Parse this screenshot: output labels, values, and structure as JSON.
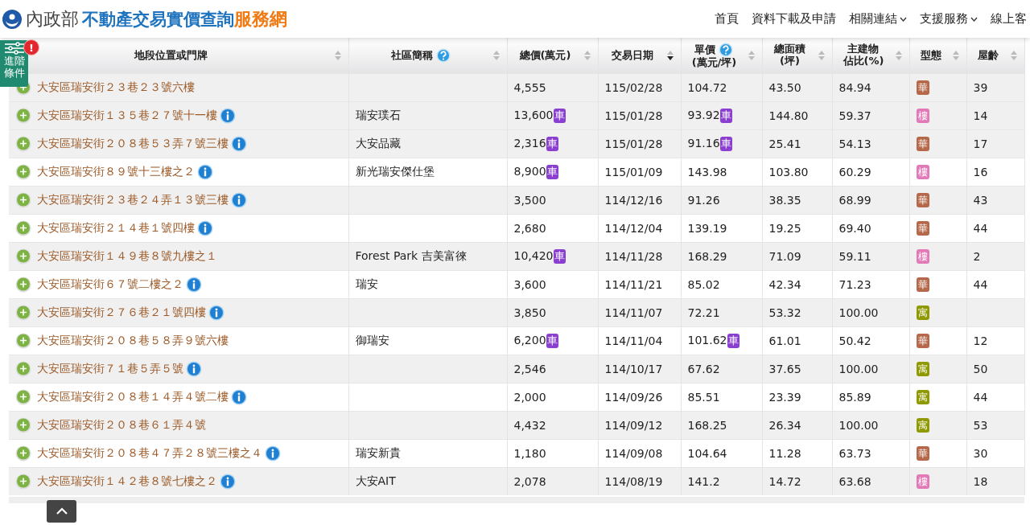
{
  "header": {
    "logo_ministry": "內政部",
    "logo_title": "不動產交易實價查詢",
    "logo_suffix": "服務網",
    "nav": [
      {
        "label": "首頁",
        "dropdown": false
      },
      {
        "label": "資料下載及申請",
        "dropdown": false
      },
      {
        "label": "相關連結",
        "dropdown": true
      },
      {
        "label": "支援服務",
        "dropdown": true
      },
      {
        "label": "線上客",
        "dropdown": false
      }
    ]
  },
  "filter_tab": {
    "label": "進階條件",
    "alert": "!"
  },
  "table": {
    "columns": [
      {
        "lines": [
          "地段位置或門牌"
        ],
        "help": false,
        "sorted_desc": false
      },
      {
        "lines": [
          "社區簡稱"
        ],
        "help": true,
        "sorted_desc": false
      },
      {
        "lines": [
          "總價(萬元)"
        ],
        "help": false,
        "sorted_desc": false
      },
      {
        "lines": [
          "交易日期"
        ],
        "help": false,
        "sorted_desc": true
      },
      {
        "lines": [
          "單價",
          "(萬元/坪)"
        ],
        "help": true,
        "sorted_desc": false
      },
      {
        "lines": [
          "總面積",
          "(坪)"
        ],
        "help": false,
        "sorted_desc": false
      },
      {
        "lines": [
          "主建物",
          "佔比(%)"
        ],
        "help": false,
        "sorted_desc": false
      },
      {
        "lines": [
          "型態"
        ],
        "help": false,
        "sorted_desc": false
      },
      {
        "lines": [
          "屋齡"
        ],
        "help": false,
        "sorted_desc": false
      }
    ],
    "rows": [
      {
        "highlighted": true,
        "address": "大安區瑞安街２３巷２３號六樓",
        "info": false,
        "total": "4,555",
        "date": "115/02/28",
        "unit_price": "104.72",
        "area": "43.50",
        "ratio": "84.94",
        "type": {
          "label": "華",
          "color": "#b5694a"
        },
        "age": "39"
      },
      {
        "highlighted": true,
        "address": "大安區瑞安街１３５巷２７號十一樓",
        "info": true,
        "community": "瑞安璞石",
        "total": "13,600",
        "total_parking": "車",
        "date": "115/01/28",
        "unit_price": "93.92",
        "unit_parking": "車",
        "area": "144.80",
        "ratio": "59.37",
        "type": {
          "label": "樓",
          "color": "#e27ab8"
        },
        "age": "14"
      },
      {
        "highlighted": true,
        "address": "大安區瑞安街２０８巷５３弄７號三樓",
        "info": true,
        "community": "大安品藏",
        "total": "2,316",
        "total_parking": "車",
        "date": "115/01/28",
        "unit_price": "91.16",
        "unit_parking": "車",
        "area": "25.41",
        "ratio": "54.13",
        "type": {
          "label": "華",
          "color": "#b5694a"
        },
        "age": "17"
      },
      {
        "highlighted": false,
        "address": "大安區瑞安街８９號十三樓之２",
        "info": true,
        "community": "新光瑞安傑仕堡",
        "total": "8,900",
        "total_parking": "車",
        "date": "115/01/09",
        "unit_price": "143.98",
        "area": "103.80",
        "ratio": "60.29",
        "type": {
          "label": "樓",
          "color": "#e27ab8"
        },
        "age": "16"
      },
      {
        "highlighted": true,
        "address": "大安區瑞安街２３巷２４弄１３號三樓",
        "info": true,
        "total": "3,500",
        "date": "114/12/16",
        "unit_price": "91.26",
        "area": "38.35",
        "ratio": "68.99",
        "type": {
          "label": "華",
          "color": "#b5694a"
        },
        "age": "43"
      },
      {
        "highlighted": false,
        "address": "大安區瑞安街２１４巷１號四樓",
        "info": true,
        "total": "2,680",
        "date": "114/12/04",
        "unit_price": "139.19",
        "area": "19.25",
        "ratio": "69.40",
        "type": {
          "label": "華",
          "color": "#b5694a"
        },
        "age": "44"
      },
      {
        "highlighted": true,
        "address": "大安區瑞安街１４９巷８號九樓之１",
        "info": false,
        "community": "Forest Park 吉美富徠",
        "total": "10,420",
        "total_parking": "車",
        "date": "114/11/28",
        "unit_price": "168.29",
        "area": "71.09",
        "ratio": "59.11",
        "type": {
          "label": "樓",
          "color": "#e27ab8"
        },
        "age": "2"
      },
      {
        "highlighted": false,
        "address": "大安區瑞安街６７號二樓之２",
        "info": true,
        "community": "瑞安",
        "total": "3,600",
        "date": "114/11/21",
        "unit_price": "85.02",
        "area": "42.34",
        "ratio": "71.23",
        "type": {
          "label": "華",
          "color": "#b5694a"
        },
        "age": "44"
      },
      {
        "highlighted": true,
        "address": "大安區瑞安街２７６巷２１號四樓",
        "info": true,
        "total": "3,850",
        "date": "114/11/07",
        "unit_price": "72.21",
        "area": "53.32",
        "ratio": "100.00",
        "type": {
          "label": "寓",
          "color": "#8f9a00"
        }
      },
      {
        "highlighted": false,
        "address": "大安區瑞安街２０８巷５８弄９號六樓",
        "info": false,
        "community": "御瑞安",
        "total": "6,200",
        "total_parking": "車",
        "date": "114/11/04",
        "unit_price": "101.62",
        "unit_parking": "車",
        "area": "61.01",
        "ratio": "50.42",
        "type": {
          "label": "華",
          "color": "#b5694a"
        },
        "age": "12"
      },
      {
        "highlighted": true,
        "address": "大安區瑞安街７１巷５弄５號",
        "info": true,
        "total": "2,546",
        "date": "114/10/17",
        "unit_price": "67.62",
        "area": "37.65",
        "ratio": "100.00",
        "type": {
          "label": "寓",
          "color": "#8f9a00"
        },
        "age": "50"
      },
      {
        "highlighted": false,
        "address": "大安區瑞安街２０８巷１４弄４號二樓",
        "info": true,
        "total": "2,000",
        "date": "114/09/26",
        "unit_price": "85.51",
        "area": "23.39",
        "ratio": "85.89",
        "type": {
          "label": "寓",
          "color": "#8f9a00"
        },
        "age": "44"
      },
      {
        "highlighted": true,
        "address": "大安區瑞安街２０８巷６１弄４號",
        "info": false,
        "total": "4,432",
        "date": "114/09/12",
        "unit_price": "168.25",
        "area": "26.34",
        "ratio": "100.00",
        "type": {
          "label": "寓",
          "color": "#8f9a00"
        },
        "age": "53"
      },
      {
        "highlighted": false,
        "address": "大安區瑞安街２０８巷４７弄２８號三樓之４",
        "info": true,
        "community": "瑞安新貴",
        "total": "1,180",
        "date": "114/09/08",
        "unit_price": "104.64",
        "area": "11.28",
        "ratio": "63.73",
        "type": {
          "label": "華",
          "color": "#b5694a"
        },
        "age": "30"
      },
      {
        "highlighted": true,
        "address": "大安區瑞安街１４２巷８號七樓之２",
        "info": true,
        "community": "大安AIT",
        "total": "2,078",
        "date": "114/08/19",
        "unit_price": "141.2",
        "area": "14.72",
        "ratio": "63.68",
        "type": {
          "label": "樓",
          "color": "#e27ab8"
        },
        "age": "18"
      }
    ]
  }
}
